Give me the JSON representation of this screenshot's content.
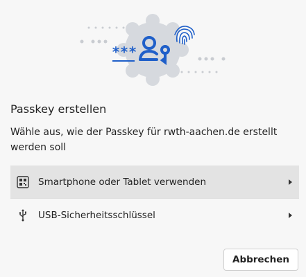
{
  "dialog": {
    "title": "Passkey erstellen",
    "description": "Wähle aus, wie der Passkey für rwth-aachen.de erstellt werden soll",
    "illustration": {
      "password_mask": "***",
      "icons": [
        "passkey-icon",
        "fingerprint-icon"
      ]
    },
    "options": [
      {
        "label": "Smartphone oder Tablet verwenden",
        "icon": "qr-code-icon",
        "highlighted": true
      },
      {
        "label": "USB-Sicherheitsschlüssel",
        "icon": "usb-icon",
        "highlighted": false
      }
    ],
    "cancel_label": "Abbrechen"
  },
  "colors": {
    "accent_blue": "#1f5fc9",
    "illustration_gray": "#d6d9de",
    "background": "#f7f7f7",
    "highlight_row": "#e3e3e3"
  }
}
